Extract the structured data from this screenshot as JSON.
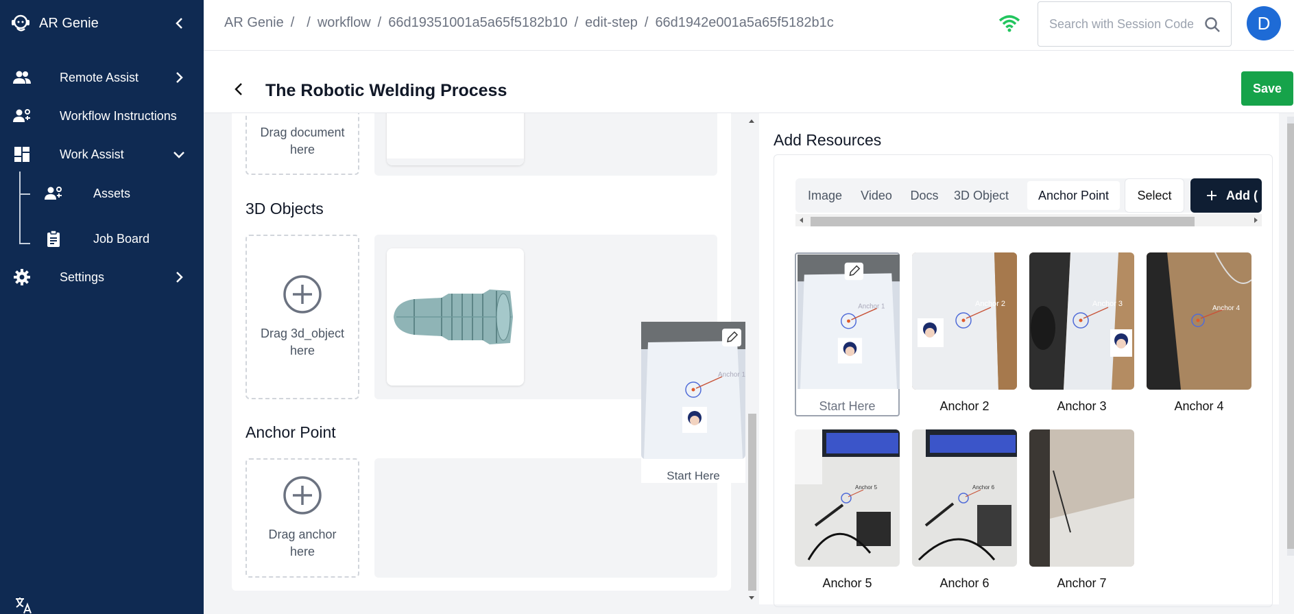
{
  "app": {
    "name": "AR Genie"
  },
  "sidebar": {
    "items": [
      {
        "label": "Remote Assist",
        "icon": "users-icon"
      },
      {
        "label": "Workflow Instructions",
        "icon": "workflow-users-icon"
      },
      {
        "label": "Work Assist",
        "icon": "dashboard-icon"
      },
      {
        "label": "Assets",
        "icon": "assets-icon"
      },
      {
        "label": "Job Board",
        "icon": "clipboard-icon"
      },
      {
        "label": "Settings",
        "icon": "gear-icon"
      }
    ]
  },
  "breadcrumb": {
    "items": [
      "AR Genie",
      "/",
      "/",
      "workflow",
      "/",
      "66d19351001a5a65f5182b10",
      "/",
      "edit-step",
      "/",
      "66d1942e001a5a65f5182b1c"
    ]
  },
  "search": {
    "placeholder": "Search with Session Code"
  },
  "user": {
    "initial": "D"
  },
  "page": {
    "title": "The Robotic Welding Process",
    "save_label": "Save"
  },
  "left": {
    "doc_drop": "Drag document here",
    "objects_title": "3D Objects",
    "object_drop": "Drag 3d_object here",
    "anchor_title": "Anchor Point",
    "anchor_drop": "Drag anchor here",
    "dragging_label": "Start Here"
  },
  "resources": {
    "title": "Add Resources",
    "tabs": [
      "Image",
      "Video",
      "Docs",
      "3D Object",
      "Anchor Point"
    ],
    "active_tab": "Anchor Point",
    "select_label": "Select",
    "add_label": "Add (",
    "items": [
      {
        "label": "Start Here",
        "tag": "Anchor 1"
      },
      {
        "label": "Anchor 2",
        "tag": "Anchor 2"
      },
      {
        "label": "Anchor 3",
        "tag": "Anchor 3"
      },
      {
        "label": "Anchor 4",
        "tag": "Anchor 4"
      },
      {
        "label": "Anchor 5",
        "tag": "Anchor 5"
      },
      {
        "label": "Anchor 6",
        "tag": "Anchor 6"
      },
      {
        "label": "Anchor 7",
        "tag": ""
      }
    ]
  },
  "colors": {
    "sidebar": "#0f2a52",
    "save": "#16a34a",
    "avatar": "#1e6bd6",
    "wifi": "#22c55e"
  }
}
